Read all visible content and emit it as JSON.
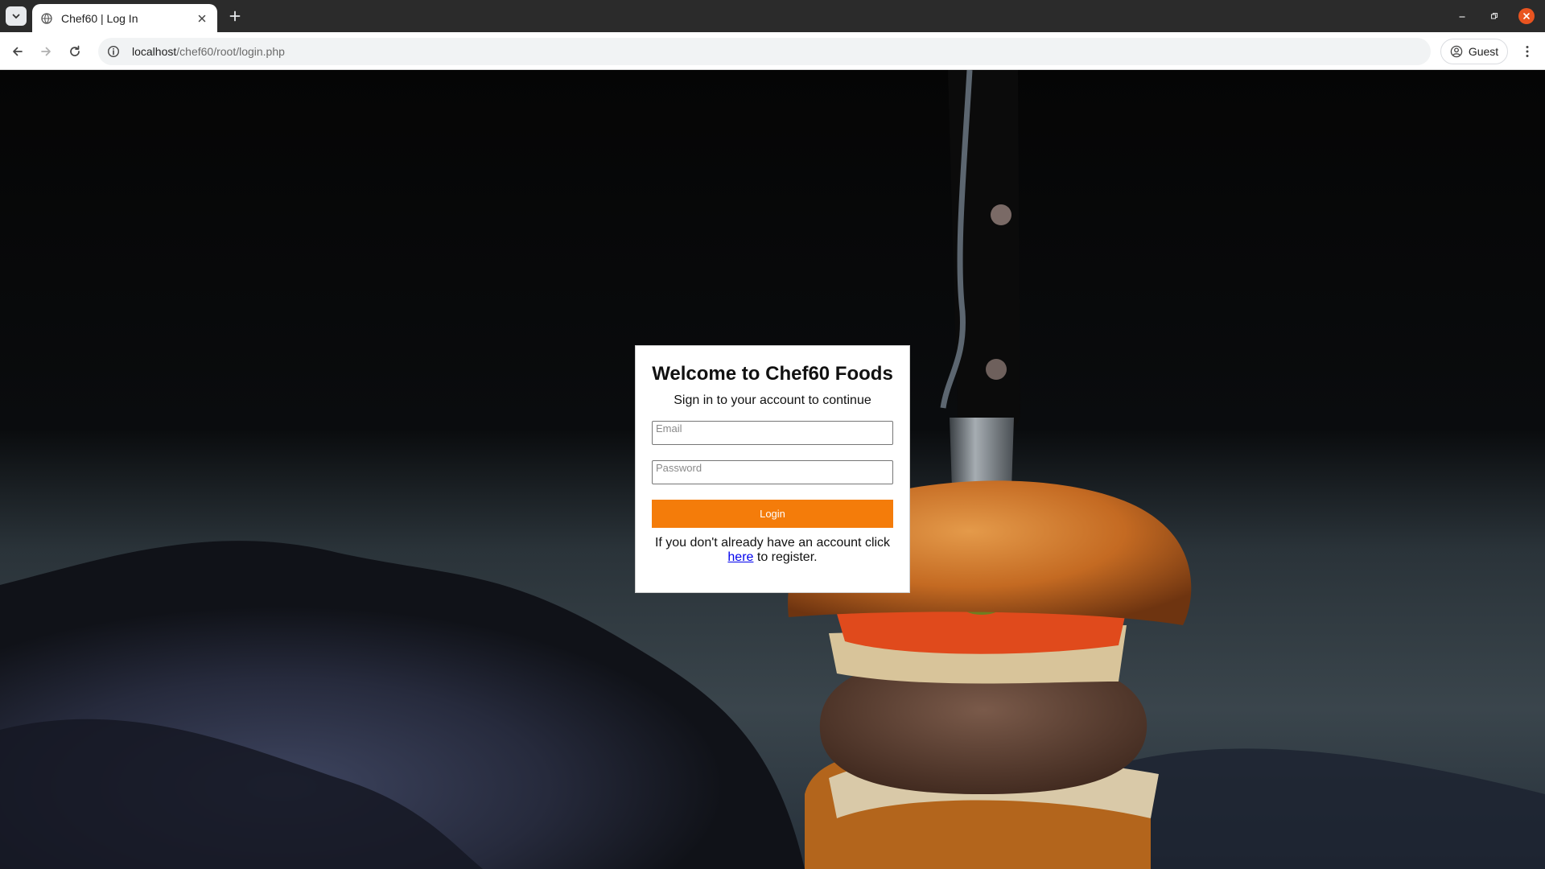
{
  "browser": {
    "tab": {
      "title": "Chef60 | Log In"
    },
    "address": {
      "host": "localhost",
      "path": "/chef60/root/login.php"
    },
    "profile": {
      "label": "Guest"
    },
    "icons": {
      "tab_list": "chevron-down-icon",
      "favicon": "globe-icon",
      "tab_close": "close-icon",
      "new_tab": "plus-icon",
      "back": "arrow-left-icon",
      "forward": "arrow-right-icon",
      "reload": "reload-icon",
      "site_info": "info-icon",
      "profile": "person-icon",
      "menu": "kebab-menu-icon"
    }
  },
  "login": {
    "heading": "Welcome to Chef60 Foods",
    "subheading": "Sign in to your account to continue",
    "email_placeholder": "Email",
    "password_placeholder": "Password",
    "button_label": "Login",
    "register_prefix": "If you don't already have an account click",
    "register_link": "here",
    "register_suffix": "to register."
  },
  "colors": {
    "accent": "#f47c0a",
    "link": "#0000ee",
    "close_button": "#e95420"
  }
}
